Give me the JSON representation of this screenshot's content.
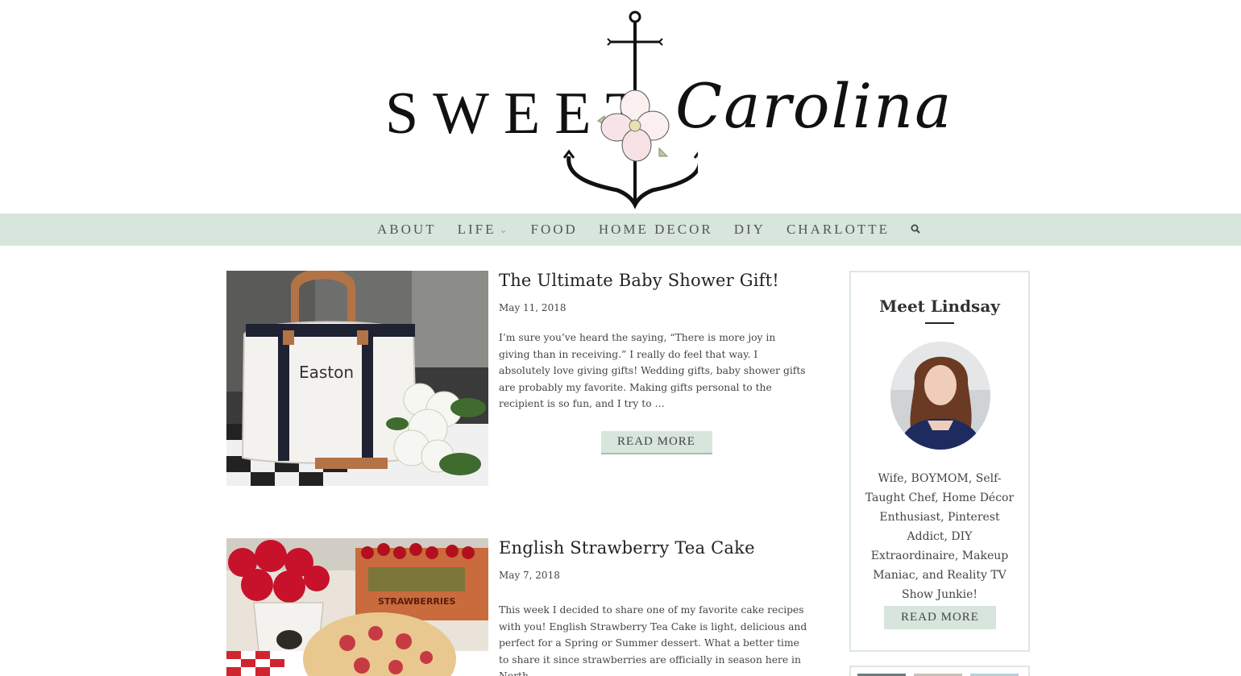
{
  "logo": {
    "word1": "SWEET",
    "word2": "Carolina"
  },
  "nav": {
    "items": [
      "ABOUT",
      "LIFE",
      "FOOD",
      "HOME DECOR",
      "DIY",
      "CHARLOTTE"
    ],
    "life_has_dropdown": true
  },
  "posts": [
    {
      "title": "The Ultimate Baby Shower Gift!",
      "date": "May 11, 2018",
      "excerpt": "I’m sure you’ve heard the saying, “There is more joy in giving than in receiving.” I really do feel that way. I absolutely love giving gifts! Wedding gifts, baby shower gifts are probably my favorite.  Making gifts personal to the recipient is so fun, and I try to …",
      "button": "READ MORE",
      "image_text": "Easton"
    },
    {
      "title": "English Strawberry Tea Cake",
      "date": "May 7, 2018",
      "excerpt": "This week I decided to share one of my favorite cake recipes with you! English Strawberry Tea Cake is light, delicious and perfect for a Spring or Summer dessert.  What a better time to share it since strawberries are officially in season here in North …",
      "button": "READ MORE",
      "image_text": "STRAWBERRIES"
    }
  ],
  "sidebar": {
    "title": "Meet Lindsay",
    "bio": "Wife, BOYMOM, Self-Taught Chef, Home Décor Enthusiast, Pinterest Addict, DIY Extraordinaire, Makeup Maniac, and Reality TV Show Junkie!",
    "button": "READ MORE"
  },
  "colors": {
    "nav_bg": "#d7e5dd",
    "button_bg": "#d7e5dd",
    "text": "#444444"
  }
}
